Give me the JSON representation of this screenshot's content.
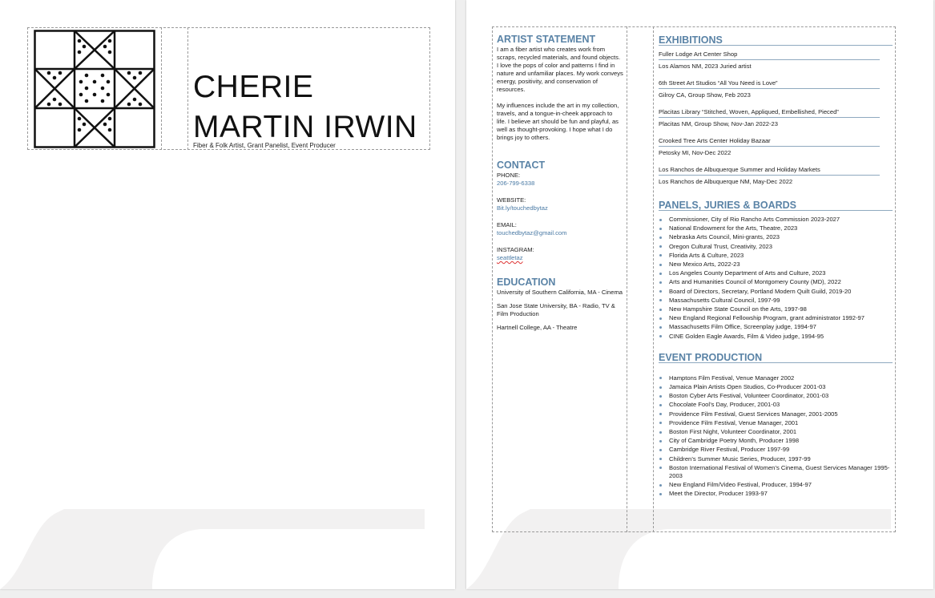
{
  "colors": {
    "accent": "#5a83a6",
    "link": "#4a7aa5",
    "background": "#efefef",
    "swoosh": "#f2f1f1"
  },
  "header": {
    "logo_icon": "ohio-star-quilt-block",
    "name_line1": "CHERIE",
    "name_line2": "MARTIN IRWIN",
    "tagline": "Fiber & Folk Artist, Grant Panelist, Event Producer"
  },
  "artist_statement": {
    "heading": "ARTIST STATEMENT",
    "paragraphs": [
      "I am a fiber artist who creates work from scraps, recycled materials, and found objects. I love the pops of color and patterns I find in nature and unfamiliar places. My work conveys energy, positivity, and conservation of resources.",
      "My influences include the art in my collection, travels, and a tongue-in-cheek approach to life. I believe art should be fun and playful, as well as thought-provoking. I hope what I do brings joy to others."
    ]
  },
  "contact": {
    "heading": "CONTACT",
    "phone_label": "PHONE:",
    "phone": "206-799-6338",
    "website_label": "WEBSITE:",
    "website": "Bit.ly/touchedbytaz",
    "email_label": "EMAIL:",
    "email": "touchedbytaz@gmail.com",
    "instagram_label": "INSTAGRAM:",
    "instagram": "seattletaz"
  },
  "education": {
    "heading": "EDUCATION",
    "items": [
      "University of Southern California, MA - Cinema",
      "San Jose State University, BA - Radio, TV & Film Production",
      "Hartnell College, AA - Theatre"
    ]
  },
  "exhibitions": {
    "heading": "EXHIBITIONS",
    "items": [
      {
        "title": "Fuller Lodge Art Center Shop",
        "detail": "Los Alamos NM, 2023 Juried artist"
      },
      {
        "title": "6th Street Art Studios “All You Need is Love”",
        "detail": "Gilroy CA, Group Show, Feb 2023"
      },
      {
        "title": "Placitas Library “Stitched, Woven, Appliqued, Embellished, Pieced”",
        "detail": "Placitas NM, Group Show, Nov-Jan 2022-23"
      },
      {
        "title": "Crooked Tree Arts Center Holiday Bazaar",
        "detail": "Petosky MI, Nov-Dec 2022"
      },
      {
        "title": "Los Ranchos de Albuquerque Summer and Holiday Markets",
        "detail": "Los Ranchos de Albuquerque NM, May-Dec 2022"
      }
    ]
  },
  "panels": {
    "heading": "PANELS, JURIES & BOARDS",
    "items": [
      "Commissioner, City of Rio Rancho Arts Commission 2023-2027",
      "National Endowment for the Arts, Theatre, 2023",
      "Nebraska Arts Council, Mini-grants, 2023",
      "Oregon Cultural Trust, Creativity, 2023",
      "Florida Arts & Culture, 2023",
      "New Mexico Arts, 2022-23",
      "Los Angeles County Department of Arts and Culture, 2023",
      "Arts and Humanities Council of Montgomery County (MD), 2022",
      "Board of Directors, Secretary, Portland Modern Quilt Guild, 2019-20",
      "Massachusetts Cultural Council, 1997-99",
      "New Hampshire State Council on the Arts, 1997-98",
      "New England Regional Fellowship Program, grant administrator 1992-97",
      "Massachusetts Film Office, Screenplay judge, 1994-97",
      "CINE Golden Eagle Awards, Film & Video judge, 1994-95"
    ]
  },
  "events": {
    "heading": "EVENT PRODUCTION",
    "items": [
      "Hamptons Film Festival, Venue Manager 2002",
      "Jamaica Plain Artists Open Studios, Co-Producer 2001-03",
      "Boston Cyber Arts Festival, Volunteer Coordinator, 2001-03",
      "Chocolate Fool’s Day, Producer, 2001-03",
      "Providence Film Festival, Guest Services Manager, 2001-2005",
      "Providence Film Festival, Venue Manager, 2001",
      "Boston First Night, Volunteer Coordinator, 2001",
      "City of Cambridge Poetry Month, Producer 1998",
      "Cambridge River Festival, Producer 1997-99",
      "Children’s Summer Music Series, Producer, 1997-99",
      "Boston International Festival of Women’s Cinema, Guest Services Manager 1995-2003",
      "New England Film/Video Festival, Producer, 1994-97",
      "Meet the Director, Producer 1993-97"
    ]
  }
}
